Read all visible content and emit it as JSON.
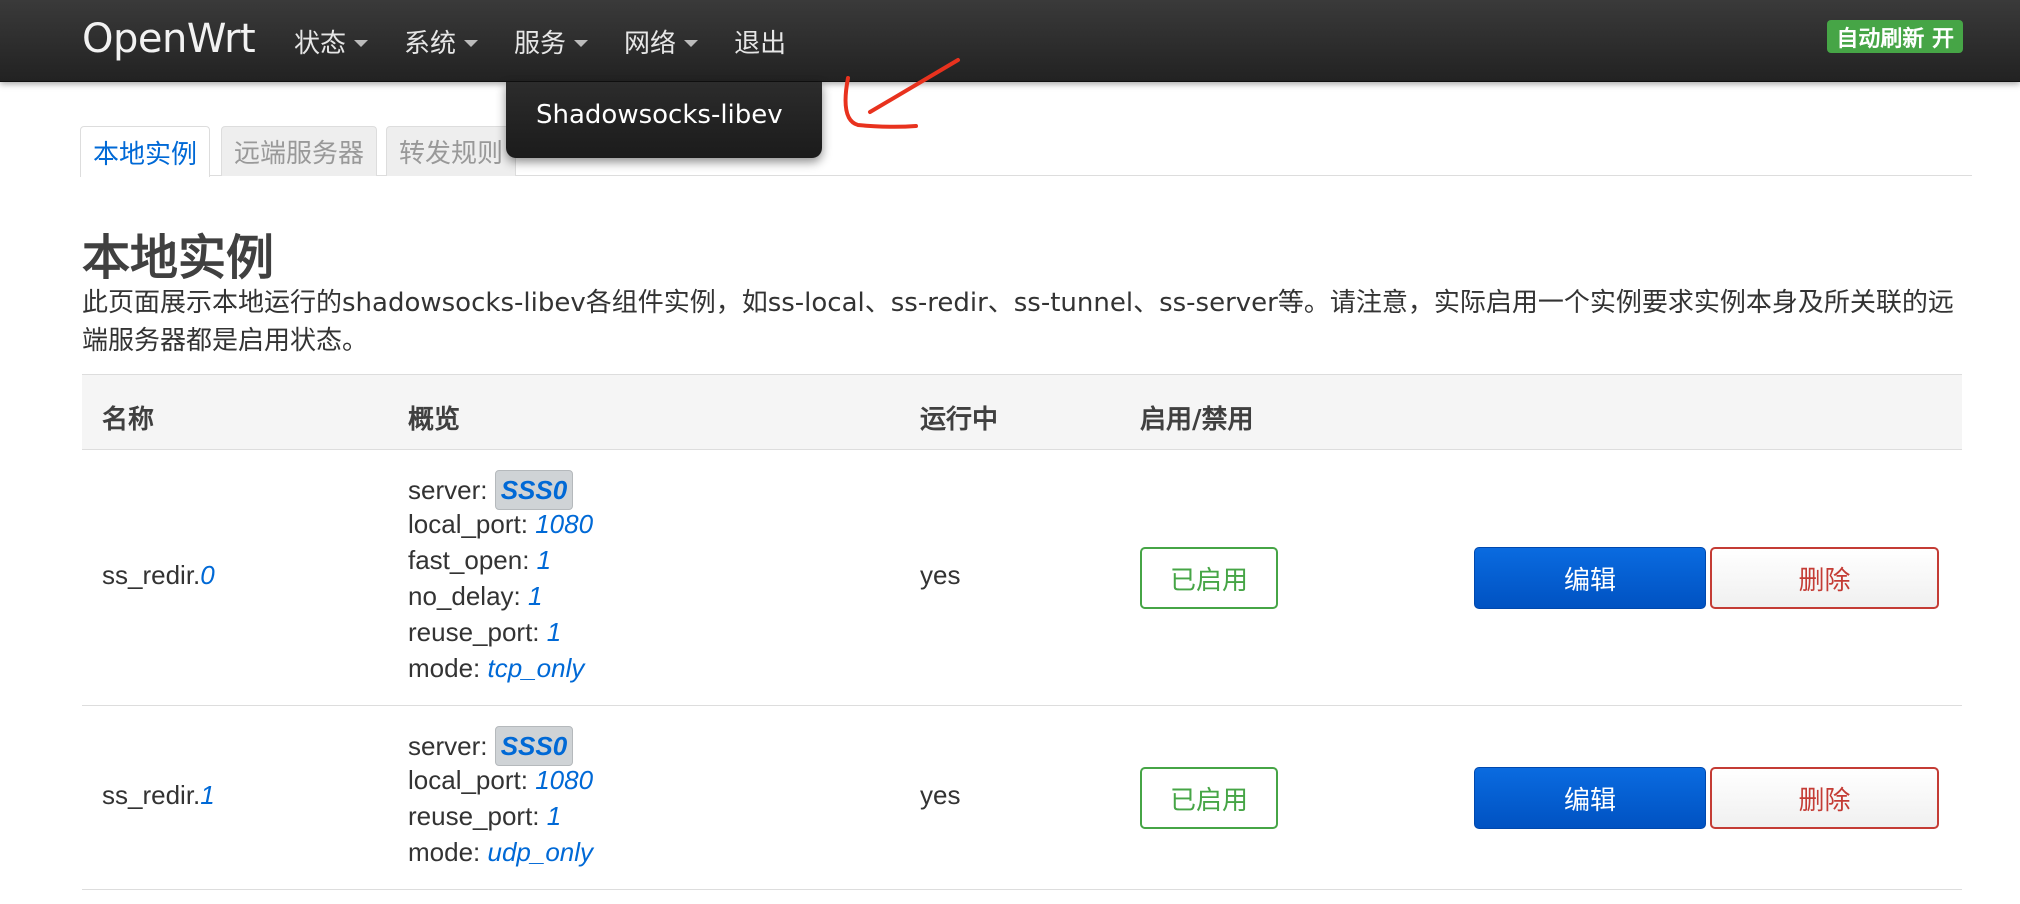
{
  "navbar": {
    "brand": "OpenWrt",
    "menu": [
      {
        "label": "状态",
        "has_caret": true
      },
      {
        "label": "系统",
        "has_caret": true
      },
      {
        "label": "服务",
        "has_caret": true
      },
      {
        "label": "网络",
        "has_caret": true
      },
      {
        "label": "退出",
        "has_caret": false
      }
    ],
    "auto_refresh": "自动刷新 开"
  },
  "dropdown": {
    "items": [
      "Shadowsocks-libev"
    ]
  },
  "tabs": [
    {
      "label": "本地实例",
      "active": true
    },
    {
      "label": "远端服务器",
      "active": false
    },
    {
      "label": "转发规则",
      "active": false
    }
  ],
  "page": {
    "title": "本地实例",
    "description": "此页面展示本地运行的shadowsocks-libev各组件实例，如ss-local、ss-redir、ss-tunnel、ss-server等。请注意，实际启用一个实例要求实例本身及所关联的远端服务器都是启用状态。"
  },
  "table": {
    "headers": [
      "名称",
      "概览",
      "运行中",
      "启用/禁用"
    ],
    "rows": [
      {
        "name_prefix": "ss_redir.",
        "name_index": "0",
        "overview": [
          {
            "key": "server: ",
            "value": "SSS0",
            "boxed": true
          },
          {
            "key": "local_port: ",
            "value": "1080"
          },
          {
            "key": "fast_open: ",
            "value": "1"
          },
          {
            "key": "no_delay: ",
            "value": "1"
          },
          {
            "key": "reuse_port: ",
            "value": "1"
          },
          {
            "key": "mode: ",
            "value": "tcp_only"
          }
        ],
        "running": "yes",
        "enabled_label": "已启用",
        "edit_label": "编辑",
        "delete_label": "删除"
      },
      {
        "name_prefix": "ss_redir.",
        "name_index": "1",
        "overview": [
          {
            "key": "server: ",
            "value": "SSS0",
            "boxed": true
          },
          {
            "key": "local_port: ",
            "value": "1080"
          },
          {
            "key": "reuse_port: ",
            "value": "1"
          },
          {
            "key": "mode: ",
            "value": "udp_only"
          }
        ],
        "running": "yes",
        "enabled_label": "已启用",
        "edit_label": "编辑",
        "delete_label": "删除"
      }
    ]
  },
  "colors": {
    "accent_blue": "#0069d6",
    "success_green": "#46a546",
    "danger_red": "#c43c35",
    "annotation_red": "#e8321e"
  }
}
